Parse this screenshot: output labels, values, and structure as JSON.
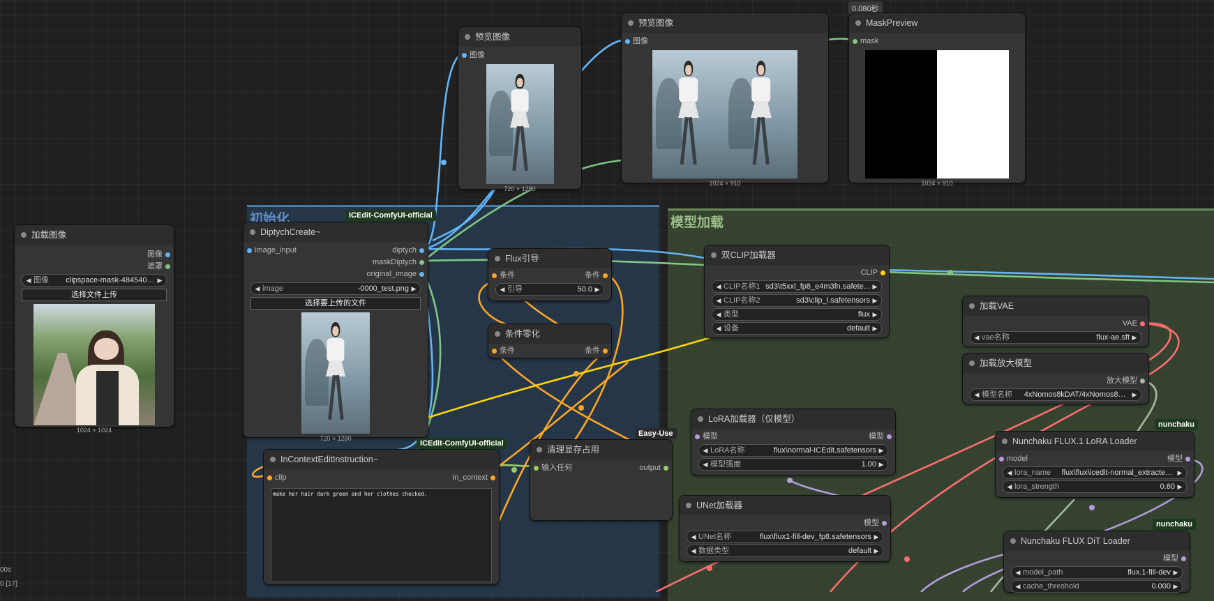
{
  "groups": {
    "init": "初始化",
    "model": "模型加载"
  },
  "badges": {
    "icedit1": "ICEdit-ComfyUI-official",
    "icedit2": "ICEdit-ComfyUI-official",
    "easyuse": "Easy-Use",
    "nunchaku1": "nunchaku",
    "nunchaku2": "nunchaku",
    "timing": "0.080秒"
  },
  "load_image": {
    "title": "加载图像",
    "out_image": "图像",
    "out_mask": "遮罩",
    "widget_label": "图像",
    "widget_value": "clipspace-mask-484540.6....",
    "upload_button": "选择文件上传",
    "caption": "1024 × 1024"
  },
  "preview1": {
    "title": "预览图像",
    "in_image": "图像",
    "caption": "720 × 1280"
  },
  "preview2": {
    "title": "预览图像",
    "in_image": "图像",
    "caption": "1024 × 910"
  },
  "mask_preview": {
    "title": "MaskPreview",
    "in_mask": "mask",
    "caption": "1024 × 910"
  },
  "diptych": {
    "title": "DiptychCreate~",
    "in_image": "image_input",
    "out_diptych": "diptych",
    "out_mask": "maskDiptych",
    "out_original": "original_image",
    "widget_label": "image",
    "widget_value": "-0000_test.png",
    "upload_button": "选择要上传的文件",
    "caption": "720 × 1280"
  },
  "flux_guidance": {
    "title": "Flux引导",
    "in_cond": "条件",
    "out_cond": "条件",
    "widget_label": "引导",
    "widget_value": "50.0"
  },
  "cond_zero": {
    "title": "条件零化",
    "in_cond": "条件",
    "out_cond": "条件"
  },
  "dual_clip": {
    "title": "双CLIP加载器",
    "out_clip": "CLIP",
    "widgets": [
      {
        "label": "CLIP名称1",
        "value": "sd3\\t5xxl_fp8_e4m3fn.safete..."
      },
      {
        "label": "CLIP名称2",
        "value": "sd3\\clip_l.safetensors"
      },
      {
        "label": "类型",
        "value": "flux"
      },
      {
        "label": "设备",
        "value": "default"
      }
    ]
  },
  "load_vae": {
    "title": "加载VAE",
    "out_vae": "VAE",
    "widget_label": "vae名称",
    "widget_value": "flux-ae.sft"
  },
  "upscale_loader": {
    "title": "加载放大模型",
    "out_model": "放大模型",
    "widget_label": "模型名称",
    "widget_value": "4xNomos8kDAT/4xNomos8kD..."
  },
  "lora_loader": {
    "title": "LoRA加载器（仅模型）",
    "in_model": "模型",
    "out_model": "模型",
    "widgets": [
      {
        "label": "LoRA名称",
        "value": "flux\\normal-ICEdit.safetensors"
      },
      {
        "label": "模型强度",
        "value": "1.00"
      }
    ]
  },
  "nunchaku_lora": {
    "title": "Nunchaku FLUX.1 LoRA Loader",
    "in_model": "model",
    "out_model": "模型",
    "widgets": [
      {
        "label": "lora_name",
        "value": "flux\\flux\\icedit-normal_extracted_l..."
      },
      {
        "label": "lora_strength",
        "value": "0.60"
      }
    ]
  },
  "unet_loader": {
    "title": "UNet加载器",
    "out_model": "模型",
    "widgets": [
      {
        "label": "UNet名称",
        "value": "flux\\flux1-fill-dev_fp8.safetensors"
      },
      {
        "label": "数据类型",
        "value": "default"
      }
    ]
  },
  "nunchaku_dit": {
    "title": "Nunchaku FLUX DiT Loader",
    "out_model": "模型",
    "widgets": [
      {
        "label": "model_path",
        "value": "flux.1-fill-dev"
      },
      {
        "label": "cache_threshold",
        "value": "0.000"
      }
    ]
  },
  "incontext": {
    "title": "InContextEditInstruction~",
    "in_clip": "clip",
    "out_context": "In_context",
    "text": "make her hair dark green and her clothes checked."
  },
  "vram_clean": {
    "title": "清理显存占用",
    "in_any": "输入任何",
    "out_output": "output"
  },
  "corner": {
    "line1": "00s",
    "line2": "0 [17]"
  },
  "colors": {
    "image": "#64b5f6",
    "mask": "#81c784",
    "conditioning": "#ffa726",
    "clip": "#ffd600",
    "vae": "#ff6e6e",
    "model": "#b39ddb"
  }
}
